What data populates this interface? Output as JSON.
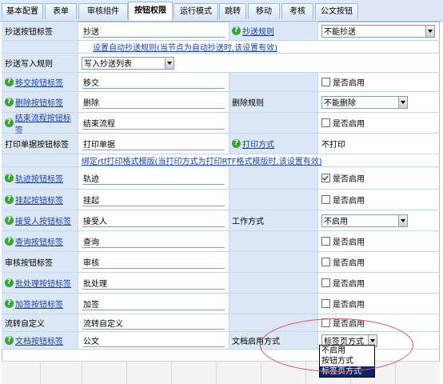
{
  "tabs": [
    "基本配置",
    "表单",
    "审核组件",
    "按钮权限",
    "运行模式",
    "跳转",
    "移动",
    "考核",
    "公文按钮"
  ],
  "active_tab": "按钮权限",
  "rows": {
    "r1": {
      "label": "抄送按钮标签",
      "value": "抄送",
      "label2": "抄送规则",
      "select": "不能抄送"
    },
    "r2": {
      "link": "设置自动抄送规则(当节点为自动抄送时,该设置有效)"
    },
    "r3": {
      "label": "抄送写入规则",
      "select": "写入抄送列表"
    },
    "r4": {
      "label": "移交按钮标签",
      "value": "移交",
      "check": "是否启用"
    },
    "r5": {
      "label": "删除按钮标签",
      "value": "删除",
      "label2": "删除规则",
      "select": "不能删除"
    },
    "r6": {
      "label": "结束流程按钮标签",
      "value": "结束流程",
      "check": "是否启用"
    },
    "r7": {
      "label": "打印单据按钮标签",
      "value": "打印单据",
      "label2": "打印方式",
      "select": "不打印"
    },
    "r8": {
      "link": "绑定rtf打印格式模版(当打印方式为打印RTF格式模版时,该设置有效)"
    },
    "r9": {
      "label": "轨迹按钮标签",
      "value": "轨迹",
      "check": "是否启用"
    },
    "r10": {
      "label": "挂起按钮标签",
      "value": "挂起",
      "check": "是否启用"
    },
    "r11": {
      "label": "接受人按钮标签",
      "value": "接受人",
      "label2": "工作方式",
      "select": "不启用"
    },
    "r12": {
      "label": "查询按钮标签",
      "value": "查询",
      "check": "是否启用"
    },
    "r13": {
      "label": "审核按钮标签",
      "value": "审核",
      "check": "是否启用"
    },
    "r14": {
      "label": "批处理按钮标签",
      "value": "批处理",
      "check": "是否启用"
    },
    "r15": {
      "label": "加签按钮标签",
      "value": "加签",
      "check": "是否启用"
    },
    "r16": {
      "label": "流转自定义",
      "value": "流转自定义",
      "check": "是否启用"
    },
    "r17": {
      "label": "文档按钮标签",
      "value": "公文",
      "label2": "文档启用方式",
      "select": "标签页方式"
    }
  },
  "dropdown_options": [
    "不启用",
    "按钮方式",
    "标签页方式"
  ],
  "dropdown_selected": "标签页方式"
}
